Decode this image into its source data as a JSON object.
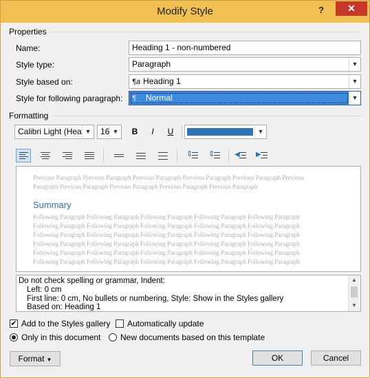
{
  "window": {
    "title": "Modify Style",
    "help_label": "?",
    "close_label": "✕"
  },
  "properties": {
    "section_label": "Properties",
    "name_label": "Name:",
    "name_value": "Heading 1  - non-numbered",
    "style_type_label": "Style type:",
    "style_type_value": "Paragraph",
    "based_on_label": "Style based on:",
    "based_on_value": "Heading 1",
    "following_label": "Style for following paragraph:",
    "following_value": "Normal"
  },
  "formatting": {
    "section_label": "Formatting",
    "font_value": "Calibri Light (Heac",
    "size_value": "16",
    "bold_label": "B",
    "italic_label": "I",
    "underline_label": "U",
    "font_color": "#2e74b5"
  },
  "preview": {
    "previous_text": "Previous Paragraph Previous Paragraph Previous Paragraph Previous Paragraph Previous Paragraph Previous Paragraph Previous Paragraph Previous Paragraph Previous Paragraph Previous Paragraph",
    "sample_text": "Summary",
    "following_text": "Following Paragraph Following Paragraph Following Paragraph Following Paragraph Following Paragraph Following Paragraph Following Paragraph Following Paragraph Following Paragraph Following Paragraph Following Paragraph Following Paragraph Following Paragraph Following Paragraph Following Paragraph Following Paragraph Following Paragraph Following Paragraph Following Paragraph Following Paragraph Following Paragraph Following Paragraph Following Paragraph Following Paragraph Following Paragraph Following Paragraph Following Paragraph Following Paragraph Following Paragraph Following Paragraph"
  },
  "description": {
    "line1": "Do not check spelling or grammar, Indent:",
    "line2": "Left:  0 cm",
    "line3": "First line:  0 cm,  No bullets or numbering, Style: Show in the Styles gallery",
    "line4": "Based on: Heading 1"
  },
  "options": {
    "add_gallery_label": "Add to the Styles gallery",
    "add_gallery_checked": true,
    "auto_update_label": "Automatically update",
    "auto_update_checked": false,
    "only_doc_label": "Only in this document",
    "new_docs_label": "New documents based on this template",
    "selected_scope": "Only in this document"
  },
  "buttons": {
    "format_label": "Format",
    "ok_label": "OK",
    "cancel_label": "Cancel"
  }
}
